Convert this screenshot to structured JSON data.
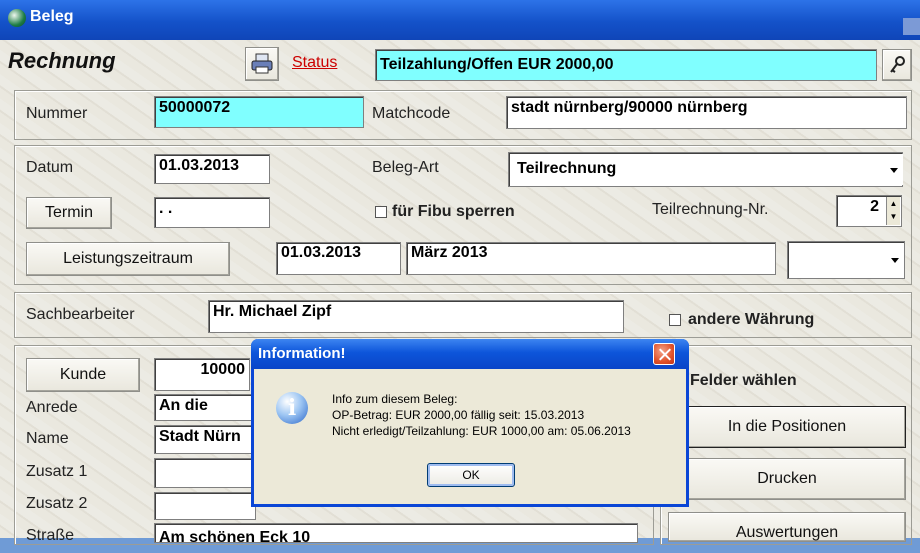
{
  "window": {
    "title": "Beleg"
  },
  "header": {
    "doc_type": "Rechnung",
    "status_link": "Status",
    "status_value": "Teilzahlung/Offen EUR 2000,00"
  },
  "fields": {
    "nummer_label": "Nummer",
    "nummer_value": "50000072",
    "matchcode_label": "Matchcode",
    "matchcode_value": "stadt nürnberg/90000 nürnberg",
    "datum_label": "Datum",
    "datum_value": "01.03.2013",
    "belegart_label": "Beleg-Art",
    "belegart_value": "Teilrechnung",
    "termin_button": "Termin",
    "termin_value": ". .",
    "fibu_label": "für Fibu sperren",
    "teilrechnung_label": "Teilrechnung-Nr.",
    "teilrechnung_value": "2",
    "leistung_button": "Leistungszeitraum",
    "leistung_date": "01.03.2013",
    "leistung_text": "März 2013",
    "sachbearbeiter_label": "Sachbearbeiter",
    "sachbearbeiter_value": "Hr. Michael Zipf",
    "waehrung_label": "andere Währung",
    "kunde_button": "Kunde",
    "kunde_value": "10000",
    "anrede_label": "Anrede",
    "anrede_value": "An die",
    "name_label": "Name",
    "name_value": "Stadt Nürn",
    "zusatz1_label": "Zusatz 1",
    "zusatz2_label": "Zusatz 2",
    "strasse_label": "Straße",
    "strasse_value": "Am schönen Eck 10"
  },
  "right_panel": {
    "felder_label": "Felder wählen",
    "positionen_button": "In die Positionen",
    "drucken_button": "Drucken",
    "auswertungen_button": "Auswertungen"
  },
  "dialog": {
    "title": "Information!",
    "line1": "Info zum diesem Beleg:",
    "line2": "OP-Betrag: EUR 2000,00 fällig seit: 15.03.2013",
    "line3": "Nicht erledigt/Teilzahlung: EUR 1000,00 am: 05.06.2013",
    "ok_button": "OK"
  },
  "colors": {
    "highlight_field": "#80ffff",
    "titlebar": "#1452c9",
    "link": "#cc0000"
  },
  "icons": [
    "app-icon",
    "printer-icon",
    "key-icon",
    "info-icon",
    "close-icon",
    "chevron-down-icon"
  ]
}
